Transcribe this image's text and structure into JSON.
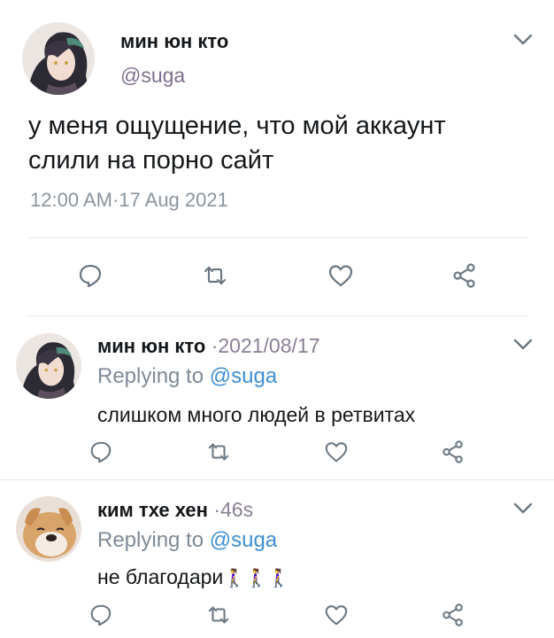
{
  "main_tweet": {
    "display_name": "мин юн кто",
    "handle": "@suga",
    "text_line1": "у меня ощущение, что мой аккаунт",
    "text_line2": "слили на порно сайт",
    "timestamp": "12:00 AM·17 Aug 2021"
  },
  "replies": [
    {
      "display_name": "мин юн кто",
      "meta": " ·2021/08/17",
      "replying_prefix": "Replying to ",
      "replying_handle": "@suga",
      "text": "слишком много людей в ретвитах"
    },
    {
      "display_name": "ким тхе хен",
      "meta": " ·46s",
      "replying_prefix": "Replying to ",
      "replying_handle": "@suga",
      "text": "не благодари",
      "emoji": "🚶‍♀️🚶‍♀️🚶‍♀️"
    }
  ],
  "icons": {
    "reply": "reply-icon",
    "retweet": "retweet-icon",
    "like": "heart-icon",
    "share": "share-icon",
    "more": "chevron-down-icon"
  },
  "colors": {
    "mention": "#3d8ed3",
    "muted": "#7f8a96",
    "icon": "#6b7782"
  }
}
